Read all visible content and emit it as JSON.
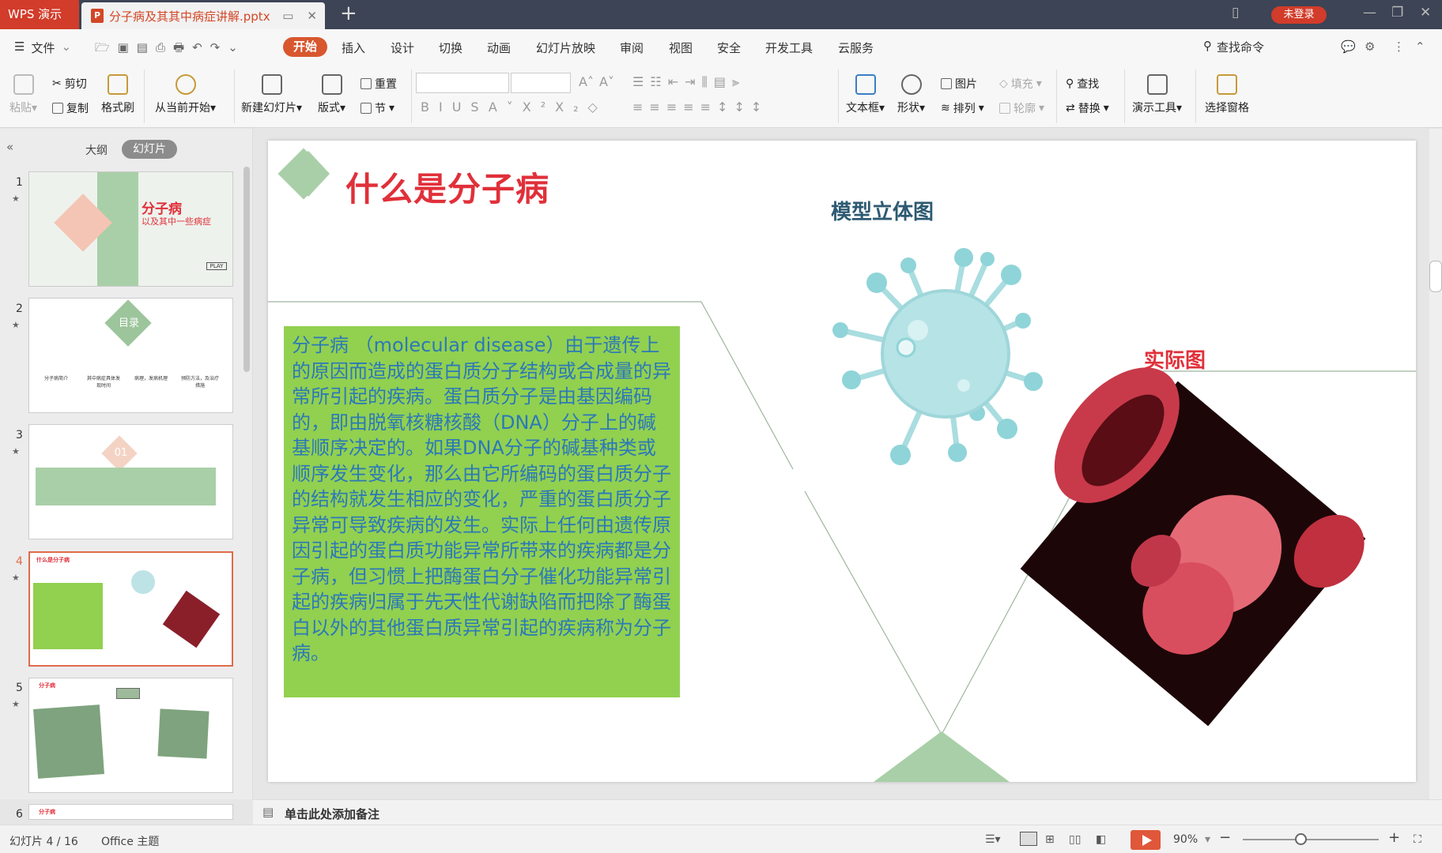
{
  "titlebar": {
    "app_name": "WPS 演示",
    "doc_tab": "分子病及其其中病症讲解.pptx",
    "login": "未登录",
    "new_tab": "+"
  },
  "menubar": {
    "file": "文件",
    "tabs": [
      "开始",
      "插入",
      "设计",
      "切换",
      "动画",
      "幻灯片放映",
      "审阅",
      "视图",
      "安全",
      "开发工具",
      "云服务"
    ],
    "search": "查找命令"
  },
  "ribbon": {
    "paste": "粘贴",
    "cut": "剪切",
    "copy": "复制",
    "format_painter": "格式刷",
    "from_current": "从当前开始",
    "new_slide": "新建幻灯片",
    "layout": "版式",
    "reset": "重置",
    "section": "节",
    "textbox": "文本框",
    "shape": "形状",
    "picture": "图片",
    "arrange": "排列",
    "fill": "填充",
    "outline": "轮廓",
    "find": "查找",
    "replace": "替换",
    "present_tools": "演示工具",
    "selection_pane": "选择窗格"
  },
  "leftpane": {
    "tab_outline": "大纲",
    "tab_slides": "幻灯片",
    "slides": [
      {
        "num": "1",
        "title": "分子病",
        "subtitle": "以及其中一些病症",
        "btn": "PLAY"
      },
      {
        "num": "2",
        "title": "目录",
        "items": [
          "分子病简介",
          "其中病症具体发现时间",
          "病理，发病机理",
          "预防方法，及治疗措施"
        ]
      },
      {
        "num": "3",
        "badge": "01"
      },
      {
        "num": "4",
        "title": "什么是分子病"
      },
      {
        "num": "5",
        "title": "分子病"
      },
      {
        "num": "6",
        "title": "分子病"
      }
    ]
  },
  "slide": {
    "title": "什么是分子病",
    "model_label": "模型立体图",
    "real_label": "实际图",
    "body": "分子病 （molecular disease）由于遗传上的原因而造成的蛋白质分子结构或合成量的异常所引起的疾病。蛋白质分子是由基因编码的，即由脱氧核糖核酸（DNA）分子上的碱基顺序决定的。如果DNA分子的碱基种类或顺序发生变化，那么由它所编码的蛋白质分子的结构就发生相应的变化，严重的蛋白质分子异常可导致疾病的发生。实际上任何由遗传原因引起的蛋白质功能异常所带来的疾病都是分子病，但习惯上把酶蛋白分子催化功能异常引起的疾病归属于先天性代谢缺陷而把除了酶蛋白以外的其他蛋白质异常引起的疾病称为分子病。"
  },
  "notes": {
    "hint": "单击此处添加备注"
  },
  "status": {
    "slide_info": "幻灯片 4 / 16",
    "theme": "Office 主题",
    "zoom": "90%"
  },
  "colors": {
    "accent": "#d8572f",
    "title_red": "#e0303a",
    "text_blue": "#2b79b8",
    "box_green": "#92d050",
    "diamond_green": "#a9cfa8"
  }
}
